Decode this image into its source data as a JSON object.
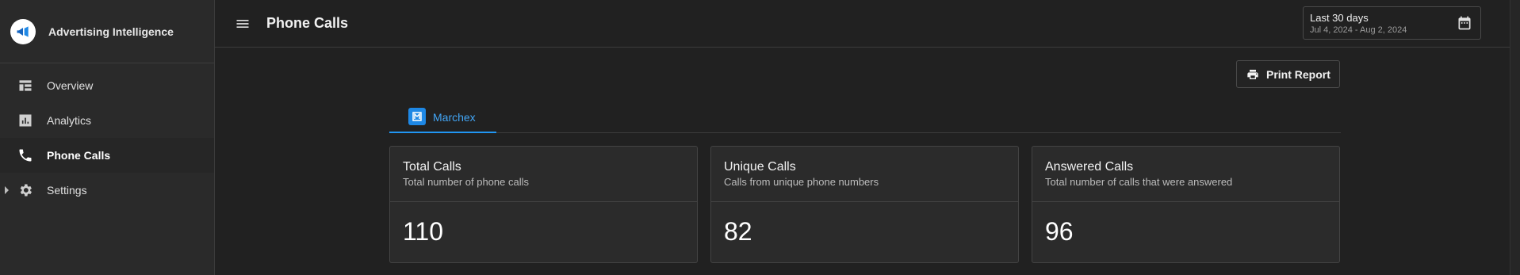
{
  "sidebar": {
    "brand": "Advertising Intelligence",
    "items": [
      {
        "label": "Overview",
        "icon": "table-icon"
      },
      {
        "label": "Analytics",
        "icon": "bar-chart-icon"
      },
      {
        "label": "Phone Calls",
        "icon": "phone-icon",
        "active": true
      },
      {
        "label": "Settings",
        "icon": "gear-icon"
      }
    ]
  },
  "header": {
    "title": "Phone Calls",
    "date_range": {
      "label": "Last 30 days",
      "range": "Jul 4, 2024 - Aug 2, 2024"
    }
  },
  "toolbar": {
    "print_label": "Print Report"
  },
  "tabs": [
    {
      "label": "Marchex",
      "active": true
    }
  ],
  "cards": [
    {
      "title": "Total Calls",
      "subtitle": "Total number of phone calls",
      "value": "110"
    },
    {
      "title": "Unique Calls",
      "subtitle": "Calls from unique phone numbers",
      "value": "82"
    },
    {
      "title": "Answered Calls",
      "subtitle": "Total number of calls that were answered",
      "value": "96"
    }
  ],
  "colors": {
    "accent": "#2196f3",
    "background": "#212121",
    "sidebar": "#2a2a2a",
    "card": "#2b2b2b"
  }
}
